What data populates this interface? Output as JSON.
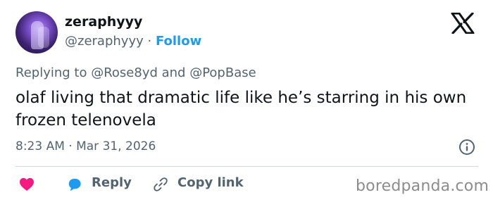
{
  "author": {
    "display_name": "zeraphyyy",
    "handle": "@zeraphyyy",
    "separator": "·",
    "follow_label": "Follow"
  },
  "reply_context": "Replying to @Rose8yd and @PopBase",
  "tweet": {
    "text": "olaf living that dramatic life like he’s starring in his own frozen telenovela",
    "timestamp": "8:23 AM · Mar 31, 2026"
  },
  "actions": {
    "reply_label": "Reply",
    "copy_link_label": "Copy link"
  },
  "watermark": "boredpanda.com",
  "colors": {
    "accent": "#1d9bf0",
    "like": "#f91880",
    "secondary_text": "#536471"
  },
  "icons": [
    "x-logo-icon",
    "info-icon",
    "heart-icon",
    "reply-bubble-icon",
    "link-icon"
  ]
}
